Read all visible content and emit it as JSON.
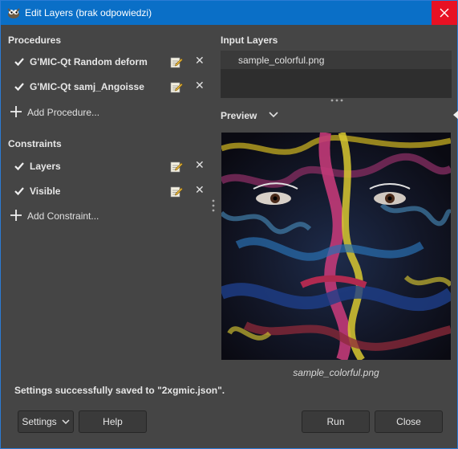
{
  "window": {
    "title": "Edit Layers (brak odpowiedzi)"
  },
  "procedures": {
    "title": "Procedures",
    "items": [
      {
        "label": "G'MIC-Qt Random deform",
        "checked": true
      },
      {
        "label": "G'MIC-Qt samj_Angoisse",
        "checked": true
      }
    ],
    "add_label": "Add Procedure..."
  },
  "constraints": {
    "title": "Constraints",
    "items": [
      {
        "label": "Layers",
        "checked": true
      },
      {
        "label": "Visible",
        "checked": true
      }
    ],
    "add_label": "Add Constraint..."
  },
  "input_layers": {
    "title": "Input Layers",
    "items": [
      "sample_colorful.png"
    ]
  },
  "preview": {
    "title": "Preview",
    "caption": "sample_colorful.png"
  },
  "status": "Settings successfully saved to \"2xgmic.json\".",
  "buttons": {
    "settings": "Settings",
    "help": "Help",
    "run": "Run",
    "close": "Close"
  },
  "colors": {
    "titlebar": "#0a6fc7",
    "close": "#e81123",
    "background": "#454545"
  }
}
